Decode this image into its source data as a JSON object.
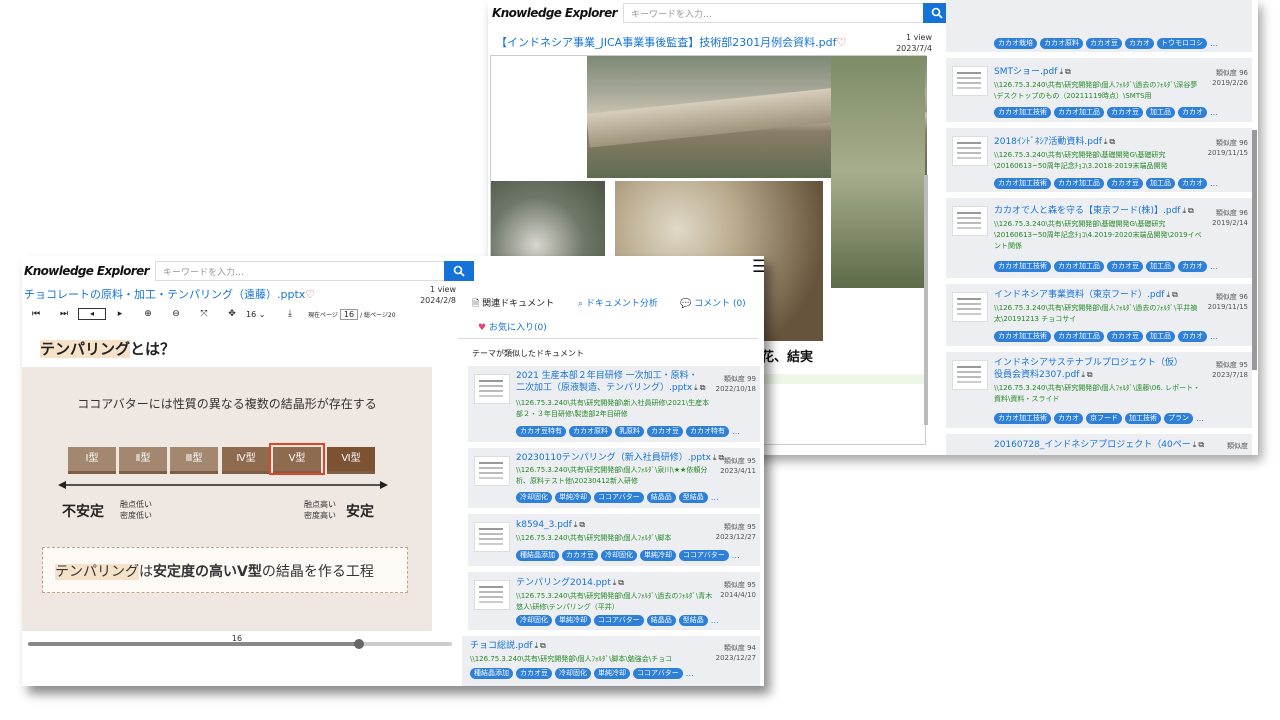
{
  "app": {
    "logo": "Knowledge Explorer",
    "search_placeholder": "キーワードを入力…"
  },
  "back": {
    "doc_title": "【インドネシア事業_JICA事業事後監査】技術部2301月例会資料.pdf",
    "views": "1 view",
    "date": "2023/7/4",
    "slide_text": "花、結実",
    "cards": [
      {
        "title": "SMTショー.pdf",
        "path": "\\\\126.75.3.240\\共有\\研究開発部\\個人ﾌｫﾙﾀﾞ\\過去のﾌｫﾙﾀﾞ\\深谷夢\\デスクトップのもの（20211119時点）\\SMTS用",
        "sim": "類似度 96",
        "date": "2019/2/26",
        "tags": [
          "カカオ加工技術",
          "カカオ加工品",
          "カカオ豆",
          "加工品",
          "カカオ"
        ]
      },
      {
        "title": "2018ｲﾝﾄﾞﾈｼｱ活動資料.pdf",
        "path": "\\\\126.75.3.240\\共有\\研究開発部\\基礎開発G\\基礎研究\\20160613~50周年記念ﾁｮｺ\\3.2018-2019末端品開発",
        "sim": "類似度 96",
        "date": "2019/11/15",
        "tags": [
          "カカオ加工技術",
          "カカオ加工品",
          "カカオ豆",
          "加工品",
          "カカオ"
        ]
      },
      {
        "title": "カカオで人と森を守る【東京フード(株)】.pdf",
        "path": "\\\\126.75.3.240\\共有\\研究開発部\\基礎開発G\\基礎研究\\20160613~50周年記念ﾁｮｺ\\4.2019-2020末端品開発\\2019イベント関係",
        "sim": "類似度 96",
        "date": "2019/2/14",
        "tags": [
          "カカオ加工技術",
          "カカオ加工品",
          "カカオ豆",
          "加工品",
          "カカオ"
        ]
      },
      {
        "title": "インドネシア事業資料（東京フード）.pdf",
        "path": "\\\\126.75.3.240\\共有\\研究開発部\\個人ﾌｫﾙﾀﾞ\\過去のﾌｫﾙﾀﾞ\\平井禎太\\20191213 チョコサイ",
        "sim": "類似度 96",
        "date": "2019/11/15",
        "tags": [
          "カカオ加工技術",
          "カカオ加工品",
          "カカオ豆",
          "加工品",
          "カカオ"
        ]
      },
      {
        "title": "インドネシアサステナブルプロジェクト（仮）役員会資料2307.pdf",
        "path": "\\\\126.75.3.240\\共有\\研究開発部\\個人ﾌｫﾙﾀﾞ\\遠藤\\06. レポート・資料\\資料・スライド",
        "sim": "類似度 95",
        "date": "2023/7/18",
        "tags": [
          "カカオ加工技術",
          "カカオ",
          "京フード",
          "加工技術",
          "プラン"
        ]
      }
    ],
    "top_tags": [
      "カカオ栽培",
      "カカオ原料",
      "カカオ豆",
      "カカオ",
      "トウモロコシ"
    ],
    "last_card_title": "20160728_インドネシアプロジェクト（40ペー",
    "last_card_sim": "類似度"
  },
  "front": {
    "doc_title": "チョコレートの原料・加工・テンパリング（遠藤）.pptx",
    "views": "1 view",
    "date": "2024/2/8",
    "page_select": "16",
    "page_current_label": "現在ページ",
    "page_current": "16",
    "page_total": "/ 総ページ20",
    "slider_value": "16",
    "slide": {
      "title_hl": "テンパリング",
      "title_rest": "とは？",
      "subtitle": "ココアバターには性質の異なる複数の結晶形が存在する",
      "types": [
        "Ⅰ型",
        "Ⅱ型",
        "Ⅲ型",
        "Ⅳ型",
        "Ⅴ型",
        "Ⅵ型"
      ],
      "unstable": "不安定",
      "unstable_note1": "融点低い",
      "unstable_note2": "密度低い",
      "stable": "安定",
      "stable_note1": "融点高い",
      "stable_note2": "密度高い",
      "conclusion_hl": "テンパリング",
      "conclusion_a": "は",
      "conclusion_b": "安定度の高いⅤ型",
      "conclusion_c": "の結晶を作る工程"
    },
    "tabs": {
      "related": "関連ドキュメント",
      "analysis": "ドキュメント分析",
      "comment": "コメント (0)",
      "favorite": "お気に入り(0)"
    },
    "section_heading": "テーマが類似したドキュメント",
    "cards": [
      {
        "title": "2021 生産本部２年目研修 一次加工・原料・二次加工（原液製造、テンパリング）.pptx",
        "path": "\\\\126.75.3.240\\共有\\研究開発部\\新入社員研修\\2021\\生産本部２・３年目研修\\製造部2年目研修",
        "sim": "類似度 99",
        "date": "2022/10/18",
        "tags": [
          "カカオ豆特有",
          "カカオ原料",
          "乳原料",
          "カカオ豆",
          "カカオ特有"
        ]
      },
      {
        "title": "20230110テンパリング（新入社員研修）.pptx",
        "path": "\\\\126.75.3.240\\共有\\研究開発部\\個人ﾌｫﾙﾀﾞ\\泉川\\★★依頼分析、原料テスト他\\20230412新入研修",
        "sim": "類似度 95",
        "date": "2023/4/11",
        "tags": [
          "冷却固化",
          "単純冷却",
          "ココアバター",
          "結晶品",
          "型結晶"
        ]
      },
      {
        "title": "k8594_3.pdf",
        "path": "\\\\126.75.3.240\\共有\\研究開発部\\個人ﾌｫﾙﾀﾞ\\脚本",
        "sim": "類似度 95",
        "date": "2023/12/27",
        "tags": [
          "種結晶添加",
          "カカオ豆",
          "冷却固化",
          "単純冷却",
          "ココアバター"
        ]
      },
      {
        "title": "テンパリング2014.ppt",
        "path": "\\\\126.75.3.240\\共有\\研究開発部\\個人ﾌｫﾙﾀﾞ\\過去のﾌｫﾙﾀﾞ\\青木悠人\\研修\\テンパリング（平井）",
        "sim": "類似度 95",
        "date": "2014/4/10",
        "tags": [
          "冷却固化",
          "単純冷却",
          "ココアバター",
          "結晶品",
          "型結晶"
        ]
      },
      {
        "title": "チョコ総説.pdf",
        "path": "\\\\126.75.3.240\\共有\\研究開発部\\個人ﾌｫﾙﾀﾞ\\脚本\\勉強会\\チョコ",
        "sim": "類似度 94",
        "date": "2023/12/27",
        "tags": [
          "種結晶添加",
          "カカオ豆",
          "冷却固化",
          "単純冷却",
          "ココアバター"
        ]
      }
    ]
  },
  "icons": {
    "search": "search-icon",
    "menu": "hamburger-icon",
    "heart": "heart-icon",
    "download": "download-icon",
    "copy": "copy-icon"
  },
  "colors": {
    "link": "#1573d8",
    "tag": "#2e7fd8",
    "path": "#258a25",
    "heart": "#e0457b",
    "highlight": "#e0452a"
  }
}
